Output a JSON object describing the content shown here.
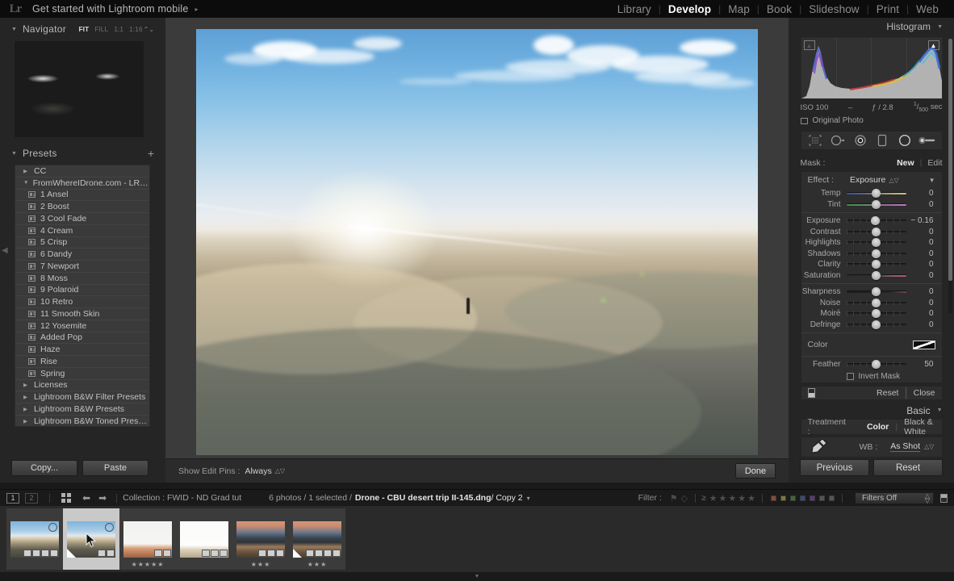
{
  "topbar": {
    "logo": "Lr",
    "identity": "Get started with Lightroom mobile",
    "identity_arrow": "▸",
    "modules": [
      {
        "label": "Library",
        "active": false
      },
      {
        "label": "Develop",
        "active": true
      },
      {
        "label": "Map",
        "active": false
      },
      {
        "label": "Book",
        "active": false
      },
      {
        "label": "Slideshow",
        "active": false
      },
      {
        "label": "Print",
        "active": false
      },
      {
        "label": "Web",
        "active": false
      }
    ]
  },
  "left_panel": {
    "navigator": {
      "title": "Navigator",
      "zoom_levels": [
        "FIT",
        "FILL",
        "1:1",
        "1:16"
      ],
      "active_zoom": "FIT",
      "stepper": "⌃⌄"
    },
    "presets": {
      "title": "Presets",
      "add_label": "+",
      "items": [
        {
          "label": "CC",
          "type": "group",
          "expanded": false
        },
        {
          "label": "FromWhereIDrone.com - LR Fre…",
          "type": "group",
          "expanded": true
        },
        {
          "label": "1 Ansel",
          "type": "preset"
        },
        {
          "label": "2 Boost",
          "type": "preset"
        },
        {
          "label": "3 Cool Fade",
          "type": "preset"
        },
        {
          "label": "4 Cream",
          "type": "preset"
        },
        {
          "label": "5 Crisp",
          "type": "preset"
        },
        {
          "label": "6 Dandy",
          "type": "preset"
        },
        {
          "label": "7 Newport",
          "type": "preset"
        },
        {
          "label": "8 Moss",
          "type": "preset"
        },
        {
          "label": "9 Polaroid",
          "type": "preset"
        },
        {
          "label": "10 Retro",
          "type": "preset"
        },
        {
          "label": "11 Smooth Skin",
          "type": "preset"
        },
        {
          "label": "12 Yosemite",
          "type": "preset"
        },
        {
          "label": "Added Pop",
          "type": "preset"
        },
        {
          "label": "Haze",
          "type": "preset"
        },
        {
          "label": "Rise",
          "type": "preset"
        },
        {
          "label": "Spring",
          "type": "preset"
        },
        {
          "label": "Licenses",
          "type": "group",
          "expanded": false
        },
        {
          "label": "Lightroom B&W Filter Presets",
          "type": "group",
          "expanded": false
        },
        {
          "label": "Lightroom B&W Presets",
          "type": "group",
          "expanded": false
        },
        {
          "label": "Lightroom B&W Toned Presets",
          "type": "group",
          "expanded": false
        }
      ]
    },
    "buttons": {
      "copy": "Copy...",
      "paste": "Paste"
    }
  },
  "center": {
    "toolbar": {
      "show_edit_pins_label": "Show Edit Pins :",
      "show_edit_pins_value": "Always",
      "done_label": "Done"
    }
  },
  "right_panel": {
    "histogram": {
      "title": "Histogram",
      "iso": "ISO 100",
      "focal": "–",
      "aperture": "ƒ / 2.8",
      "shutter_num": "1",
      "shutter_den": "500",
      "shutter_unit": "sec",
      "original_photo": "Original Photo"
    },
    "tools": [
      "crop-tool",
      "spot-removal-tool",
      "red-eye-tool",
      "graduated-filter-tool",
      "radial-filter-tool",
      "adjustment-brush-tool"
    ],
    "mask": {
      "label": "Mask :",
      "new": "New",
      "separator": "|",
      "edit": "Edit"
    },
    "effect": {
      "label": "Effect :",
      "value": "Exposure",
      "stepper": "⌃⌄",
      "dropdown": "▼"
    },
    "sliders_wb": [
      {
        "label": "Temp",
        "value": "0",
        "pos": 50,
        "grad": "temp"
      },
      {
        "label": "Tint",
        "value": "0",
        "pos": 50,
        "grad": "tint"
      }
    ],
    "sliders_tone": [
      {
        "label": "Exposure",
        "value": "− 0.16",
        "pos": 49,
        "grad": ""
      },
      {
        "label": "Contrast",
        "value": "0",
        "pos": 50,
        "grad": ""
      },
      {
        "label": "Highlights",
        "value": "0",
        "pos": 50,
        "grad": ""
      },
      {
        "label": "Shadows",
        "value": "0",
        "pos": 50,
        "grad": ""
      },
      {
        "label": "Clarity",
        "value": "0",
        "pos": 50,
        "grad": ""
      },
      {
        "label": "Saturation",
        "value": "0",
        "pos": 50,
        "grad": "sat"
      }
    ],
    "sliders_detail": [
      {
        "label": "Sharpness",
        "value": "0",
        "pos": 50,
        "grad": "sharp"
      },
      {
        "label": "Noise",
        "value": "0",
        "pos": 50,
        "grad": ""
      },
      {
        "label": "Moiré",
        "value": "0",
        "pos": 50,
        "grad": ""
      },
      {
        "label": "Defringe",
        "value": "0",
        "pos": 50,
        "grad": ""
      }
    ],
    "color_row": {
      "label": "Color"
    },
    "feather": {
      "label": "Feather",
      "value": "50",
      "pos": 50
    },
    "invert_mask": {
      "label": "Invert Mask",
      "checked": false
    },
    "reset_close": {
      "reset": "Reset",
      "separator": "|",
      "close": "Close"
    },
    "basic": {
      "title": "Basic",
      "treatment_label": "Treatment :",
      "treatment_color": "Color",
      "treatment_separator": "|",
      "treatment_bw": "Black & White",
      "wb_label": "WB :",
      "wb_value": "As Shot",
      "wb_stepper": "⌃⌄"
    },
    "buttons": {
      "previous": "Previous",
      "reset": "Reset"
    }
  },
  "filmstrip_bar": {
    "page_numbers": [
      "1",
      "2"
    ],
    "active_page": "1",
    "prev_arrow": "⬅",
    "next_arrow": "➡",
    "collection": "Collection : FWID - ND Grad tut",
    "count": "6 photos / 1 selected /",
    "filename": "Drone - CBU desert trip II-145.dng",
    "copy": " / Copy 2",
    "dropdown": "▾",
    "filter_label": "Filter :",
    "gte": "≥",
    "stars": 5,
    "color_labels": [
      "#8a4a3a",
      "#7a7a3a",
      "#3a6a3a",
      "#3a4a7a",
      "#5a3a7a",
      "#555555",
      "#555555"
    ],
    "filters_off": "Filters Off"
  },
  "filmstrip": {
    "thumbs": [
      {
        "selected": false,
        "rating": "",
        "has_circle": true,
        "has_corner": false,
        "badges": 4,
        "style": "desert-sunny"
      },
      {
        "selected": true,
        "rating": "",
        "has_circle": true,
        "has_corner": true,
        "badges": 2,
        "style": "desert-sunny"
      },
      {
        "selected": false,
        "rating": "★★★★★",
        "has_circle": false,
        "has_corner": false,
        "badges": 2,
        "style": "desert-white"
      },
      {
        "selected": false,
        "rating": "",
        "has_circle": false,
        "has_corner": false,
        "badges": 3,
        "style": "desert-white2"
      },
      {
        "selected": false,
        "rating": "★★★",
        "has_circle": false,
        "has_corner": false,
        "badges": 3,
        "style": "desert-sunset"
      },
      {
        "selected": false,
        "rating": "★★★",
        "has_circle": false,
        "has_corner": true,
        "badges": 4,
        "style": "desert-sunset"
      }
    ]
  },
  "bottom": {
    "collapse_arrow": "▼"
  }
}
